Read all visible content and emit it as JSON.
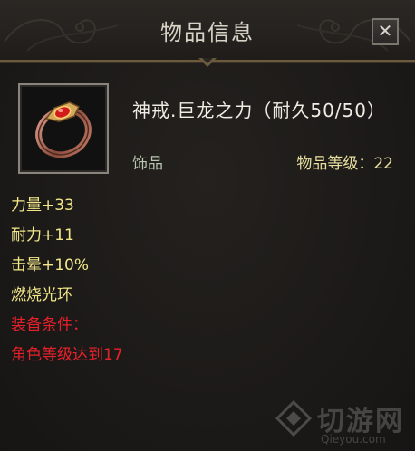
{
  "window": {
    "title": "物品信息",
    "close_label": "✕"
  },
  "item": {
    "icon": "ring-icon",
    "name": "神戒.巨龙之力（耐久50/50）",
    "type": "饰品",
    "level_text": "物品等级：22"
  },
  "attributes": [
    "力量+33",
    "耐力+11",
    "击晕+10%",
    "燃烧光环"
  ],
  "requirements": {
    "header": "装备条件：",
    "lines": [
      "角色等级达到17"
    ]
  },
  "watermark": {
    "name": "切游网",
    "url": "Qieyou.com"
  },
  "colors": {
    "attribute": "#f2e88a",
    "requirement": "#e8202a",
    "item_type": "#b8c8b0",
    "item_level": "#e8e0a0",
    "frame_gold": "#6b5a3c"
  }
}
